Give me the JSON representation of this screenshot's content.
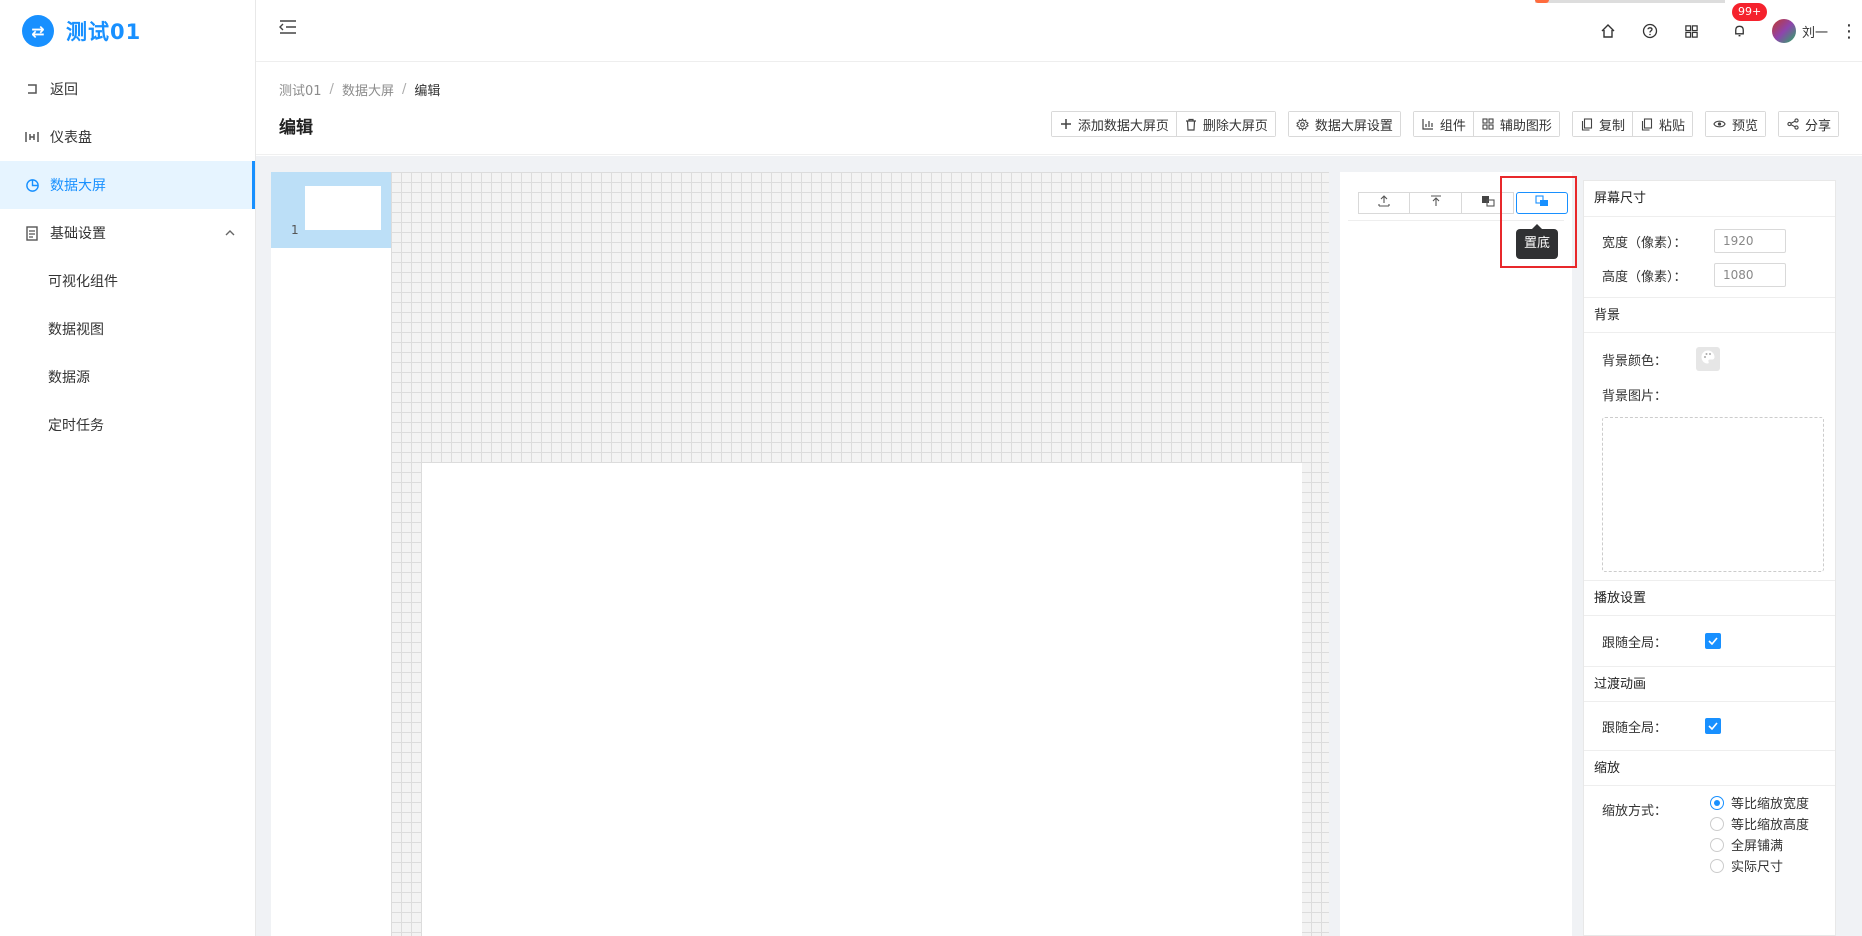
{
  "app": {
    "logo_glyph": "⇄",
    "title": "测试01",
    "accent_color": "#1890ff"
  },
  "sidebar": {
    "items": [
      {
        "label": "返回",
        "icon": "return-icon"
      },
      {
        "label": "仪表盘",
        "icon": "dashboard-icon"
      },
      {
        "label": "数据大屏",
        "icon": "pie-chart-icon",
        "active": true
      },
      {
        "label": "基础设置",
        "icon": "settings-doc-icon",
        "expanded": true
      }
    ],
    "subitems": [
      {
        "label": "可视化组件"
      },
      {
        "label": "数据视图"
      },
      {
        "label": "数据源"
      },
      {
        "label": "定时任务"
      }
    ]
  },
  "header": {
    "notification_badge": "99+",
    "username": "刘一",
    "icons": [
      "home-icon",
      "help-icon",
      "apps-icon",
      "bell-icon"
    ]
  },
  "breadcrumb": {
    "items": [
      "测试01",
      "数据大屏",
      "编辑"
    ]
  },
  "page": {
    "title": "编辑"
  },
  "toolbar": {
    "add_page": "添加数据大屏页",
    "delete_page": "删除大屏页",
    "screen_settings": "数据大屏设置",
    "components": "组件",
    "aux_shapes": "辅助图形",
    "copy": "复制",
    "paste": "粘贴",
    "preview": "预览",
    "share": "分享"
  },
  "pages_panel": {
    "pages": [
      {
        "number": "1"
      }
    ]
  },
  "layer_toolbar": {
    "buttons": [
      "move-up-icon",
      "bring-to-top-icon",
      "move-down-icon",
      "send-to-bottom-icon"
    ],
    "active_button": "send-to-bottom-icon",
    "tooltip": "置底",
    "highlight_color": "#e8282b"
  },
  "properties": {
    "screen_size": {
      "title": "屏幕尺寸",
      "width_label": "宽度（像素）：",
      "width_value": "1920",
      "height_label": "高度（像素）：",
      "height_value": "1080"
    },
    "background": {
      "title": "背景",
      "color_label": "背景颜色：",
      "image_label": "背景图片："
    },
    "playback": {
      "title": "播放设置",
      "follow_global_label": "跟随全局：",
      "follow_global_checked": true
    },
    "transition": {
      "title": "过渡动画",
      "follow_global_label": "跟随全局：",
      "follow_global_checked": true
    },
    "scale": {
      "title": "缩放",
      "mode_label": "缩放方式：",
      "options": [
        "等比缩放宽度",
        "等比缩放高度",
        "全屏铺满",
        "实际尺寸"
      ],
      "selected": "等比缩放宽度"
    }
  }
}
